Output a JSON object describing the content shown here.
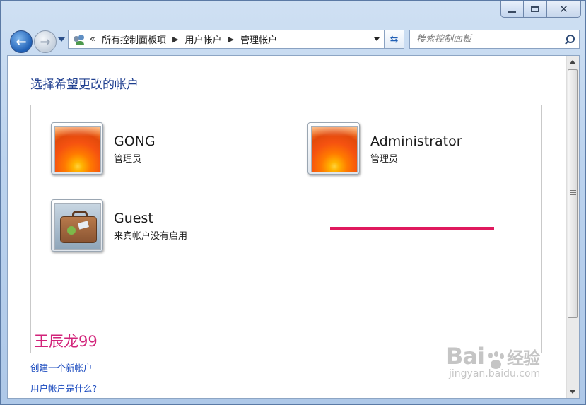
{
  "address_bar": {
    "overflow_chevron": "«",
    "breadcrumbs": [
      "所有控制面板项",
      "用户帐户",
      "管理帐户"
    ]
  },
  "search": {
    "placeholder": "搜索控制面板"
  },
  "main": {
    "heading": "选择希望更改的帐户",
    "accounts": [
      {
        "name": "GONG",
        "role": "管理员",
        "picture": "orange-flower"
      },
      {
        "name": "Administrator",
        "role": "管理员",
        "picture": "orange-flower"
      },
      {
        "name": "Guest",
        "role": "来宾帐户没有启用",
        "picture": "suitcase"
      }
    ],
    "annotation_text": "王辰龙99",
    "annotation_color": "#e0195e"
  },
  "links": {
    "create_account": "创建一个新帐户",
    "what_is_account": "用户帐户是什么?"
  },
  "watermark": {
    "logo": "Bai",
    "logo_suffix": "经验",
    "site": "jingyan.baidu.com"
  },
  "colors": {
    "heading": "#1e3e8f",
    "link": "#1b4bbf",
    "window_frame": "#bcd3ee"
  }
}
